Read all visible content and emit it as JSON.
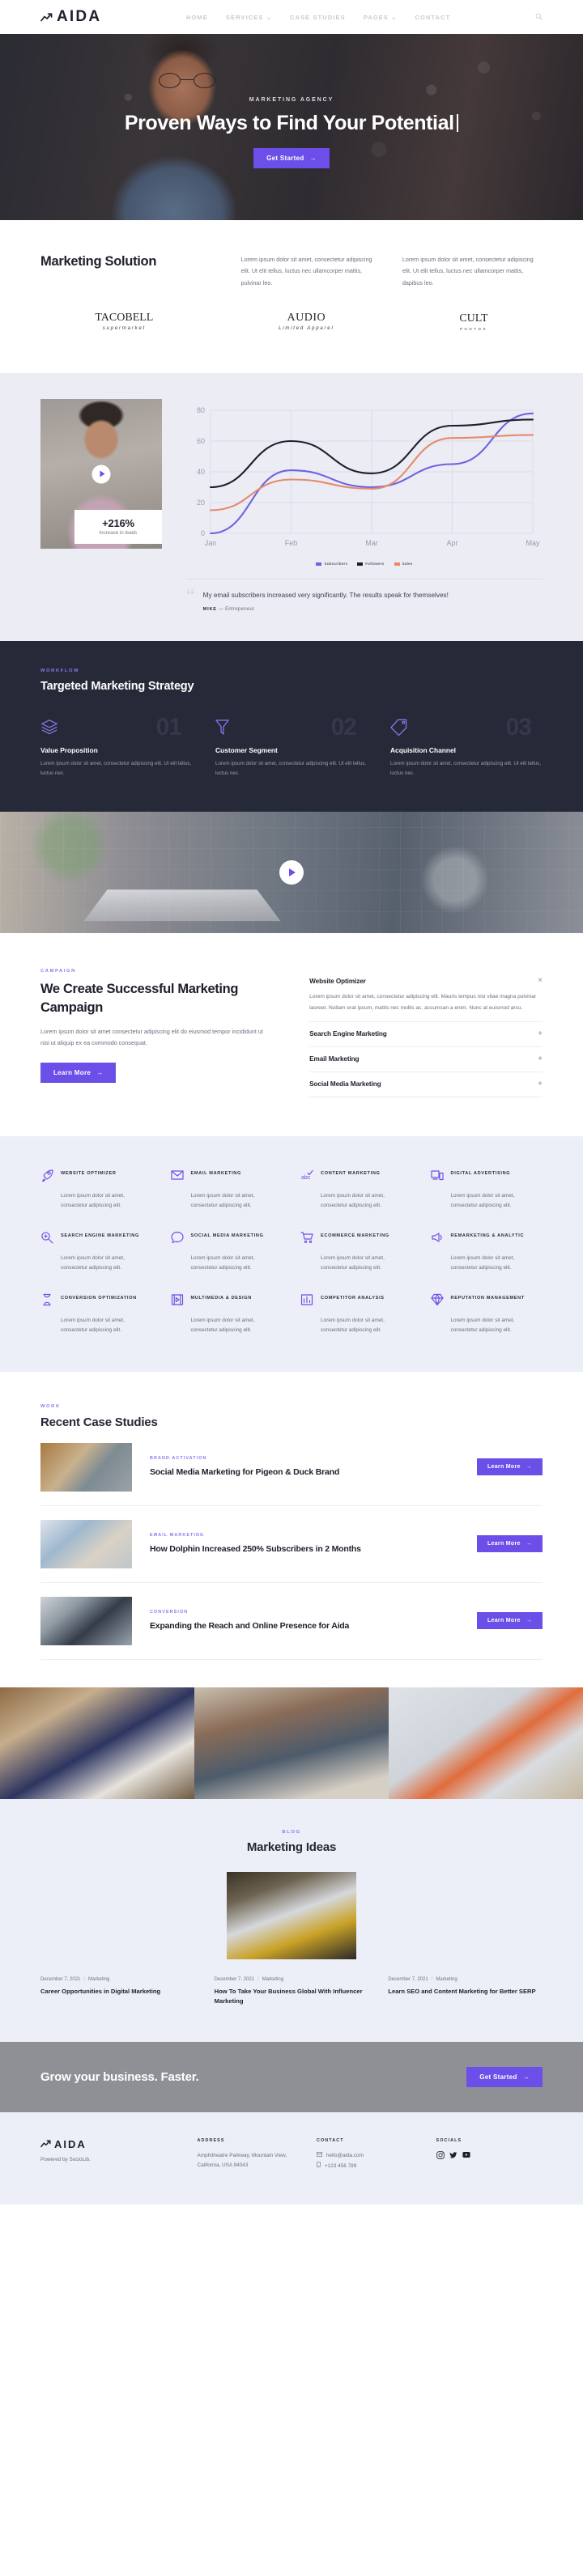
{
  "brand": {
    "name": "AIDA",
    "logo_icon": "trend-arrow-icon"
  },
  "nav": {
    "items": [
      {
        "label": "HOME"
      },
      {
        "label": "SERVICES ⌄"
      },
      {
        "label": "CASE STUDIES"
      },
      {
        "label": "PAGES ⌄"
      },
      {
        "label": "CONTACT"
      }
    ],
    "search_icon": "search-icon"
  },
  "hero": {
    "eyebrow": "MARKETING AGENCY",
    "title": "Proven Ways to Find Your Potential",
    "cta": "Get Started"
  },
  "solution": {
    "title": "Marketing Solution",
    "col1": "Lorem ipsum dolor sit amet, consectetur adipiscing elit. Ut elit tellus, luctus nec ullamcorper mattis, pulvinar leo.",
    "col2": "Lorem ipsum dolor sit amet, consectetur adipiscing elit. Ut elit tellus, luctus nec ullamcorper mattis, dapibus leo.",
    "logos": [
      {
        "main": "TACOBELL",
        "sub": "supermarket"
      },
      {
        "main": "AUDIO",
        "sub": "Limited Apparel"
      },
      {
        "main": "CULT",
        "sub": "PHOTOS"
      }
    ]
  },
  "chart_block": {
    "stat_number": "+216%",
    "stat_label": "increase in leads",
    "play_icon": "play-icon",
    "quote_icon": "quote-icon",
    "quote": "My email subscribers increased very significantly. The results speak for themselves!",
    "author": "MIKE",
    "author_role": "Entrepeneur",
    "author_sep": "—"
  },
  "chart_data": {
    "type": "line",
    "title": "",
    "x": [
      "Jan",
      "Feb",
      "Mar",
      "Apr",
      "May"
    ],
    "xlabel": "",
    "ylabel": "",
    "ylim": [
      0,
      80
    ],
    "yticks": [
      0,
      20,
      40,
      60,
      80
    ],
    "grid": true,
    "legend_position": "bottom",
    "series": [
      {
        "name": "Subscribers",
        "color": "#6c63e0",
        "values": [
          0,
          41,
          30,
          45,
          78
        ]
      },
      {
        "name": "Followers",
        "color": "#1d1f2b",
        "values": [
          30,
          60,
          39,
          70,
          74
        ]
      },
      {
        "name": "Sales",
        "color": "#e58b6c",
        "values": [
          15,
          35,
          29,
          62,
          64
        ]
      }
    ]
  },
  "workflow": {
    "eyebrow": "WORKFLOW",
    "title": "Targeted Marketing Strategy",
    "items": [
      {
        "num": "01",
        "icon": "layers-icon",
        "title": "Value Proposition",
        "text": "Lorem ipsum dolor sit amet, consectetur adipiscing elit. Ut elit tellus, luctus nec."
      },
      {
        "num": "02",
        "icon": "funnel-icon",
        "title": "Customer Segment",
        "text": "Lorem ipsum dolor sit amet, consectetur adipiscing elit. Ut elit tellus, luctus nec."
      },
      {
        "num": "03",
        "icon": "tag-icon",
        "title": "Acquisition Channel",
        "text": "Lorem ipsum dolor sit amet, consectetur adipiscing elit. Ut elit tellus, luctus nec."
      }
    ]
  },
  "campaign": {
    "eyebrow": "CAMPAIGN",
    "title": "We Create Successful Marketing Campaign",
    "text": "Lorem ipsum dolor sit amet consectetur adipiscing elit do eiusmod tempor incididunt ut  nisi ut aliquip ex ea commodo consequat.",
    "cta": "Learn More",
    "accordion": [
      {
        "title": "Website Optimizer",
        "sign": "×",
        "open": true,
        "body": "Lorem ipsum dolor sit amet, consectetur adipiscing elit. Mauris tempus nisl vitae magna pulvinar laoreet. Nullam erat ipsum, mattis nec mollis ac, accumsan a enim. Nunc at euismod arcu."
      },
      {
        "title": "Search Engine Marketing",
        "sign": "+",
        "open": false,
        "body": ""
      },
      {
        "title": "Email Marketing",
        "sign": "+",
        "open": false,
        "body": ""
      },
      {
        "title": "Social Media Marketing",
        "sign": "+",
        "open": false,
        "body": ""
      }
    ]
  },
  "services": {
    "body": "Lorem ipsum dolor sit amet, consectetur adipiscing elit.",
    "items": [
      {
        "icon": "rocket-icon",
        "title": "WEBSITE OPTIMIZER"
      },
      {
        "icon": "envelope-icon",
        "title": "EMAIL MARKETING"
      },
      {
        "icon": "abc-check-icon",
        "title": "CONTENT MARKETING"
      },
      {
        "icon": "devices-icon",
        "title": "DIGITAL ADVERTISING"
      },
      {
        "icon": "magnifier-icon",
        "title": "SEARCH ENGINE MARKETING"
      },
      {
        "icon": "chat-bubble-icon",
        "title": "SOCIAL MEDIA MARKETING"
      },
      {
        "icon": "cart-icon",
        "title": "ECOMMERCE MARKETING"
      },
      {
        "icon": "megaphone-icon",
        "title": "REMARKETING & ANALYTIC"
      },
      {
        "icon": "hourglass-icon",
        "title": "CONVERSION OPTIMIZATION"
      },
      {
        "icon": "film-icon",
        "title": "MULTIMEDIA & DESIGN"
      },
      {
        "icon": "bar-chart-icon",
        "title": "COMPETITOR ANALYSIS"
      },
      {
        "icon": "diamond-icon",
        "title": "REPUTATION MANAGEMENT"
      }
    ]
  },
  "cases": {
    "eyebrow": "WORK",
    "title": "Recent Case Studies",
    "cta": "Learn More",
    "items": [
      {
        "category": "BRAND ACTIVATION",
        "title": "Social Media Marketing for Pigeon & Duck Brand"
      },
      {
        "category": "EMAIL MARKETING",
        "title": "How Dolphin Increased 250% Subscribers in 2 Months"
      },
      {
        "category": "CONVERSION",
        "title": "Expanding the Reach and Online Presence for Aida"
      }
    ]
  },
  "blog": {
    "eyebrow": "BLOG",
    "title": "Marketing Ideas",
    "posts": [
      {
        "date": "December 7, 2021",
        "sep": "/",
        "category": "Marketing",
        "title": "Career Opportunities in Digital Marketing"
      },
      {
        "date": "December 7, 2021",
        "sep": "/",
        "category": "Marketing",
        "title": "How To Take Your Business Global With Influencer Marketing"
      },
      {
        "date": "December 7, 2021",
        "sep": "/",
        "category": "Marketing",
        "title": "Learn SEO and Content Marketing for Better SERP"
      }
    ]
  },
  "cta": {
    "title": "Grow your business. Faster.",
    "button": "Get Started"
  },
  "footer": {
    "brand": "AIDA",
    "powered": "Powered by SocioLib.",
    "address_heading": "ADDRESS",
    "address": "Amphitheatre Parkway, Mountain View, California, USA 94043",
    "contact_heading": "CONTACT",
    "email": "hello@aida.com",
    "phone": "+123 456 789",
    "socials_heading": "SOCIALS",
    "socials": [
      {
        "name": "instagram-icon",
        "glyph": "▢"
      },
      {
        "name": "twitter-icon",
        "glyph": "■"
      },
      {
        "name": "youtube-icon",
        "glyph": "■"
      }
    ]
  },
  "colors": {
    "accent": "#6c4ee8",
    "accent_light": "#8a79f0",
    "dark": "#262a38",
    "lavender_bg": "#eceef8"
  }
}
